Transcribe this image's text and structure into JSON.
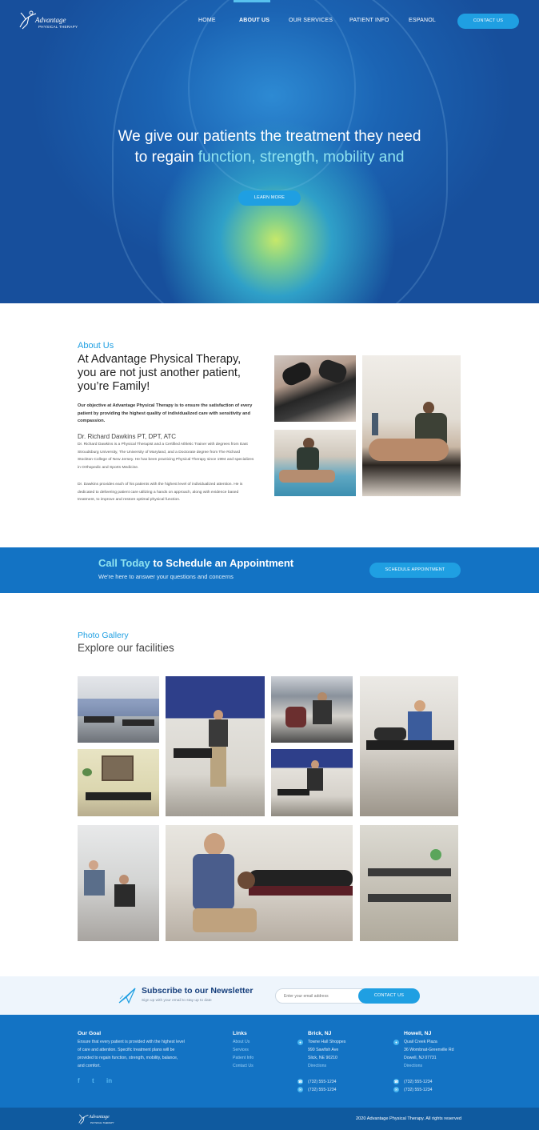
{
  "header": {
    "logo_name": "Advantage",
    "logo_sub": "PHYSICAL THERAPY",
    "nav": [
      "HOME",
      "ABOUT US",
      "OUR SERVICES",
      "PATIENT INFO",
      "ESPANOL"
    ],
    "active_nav": "ABOUT US",
    "contact_button": "CONTACT US"
  },
  "hero": {
    "line1": "We give our patients the treatment they need",
    "line2_plain": "to regain ",
    "line2_highlight": "function, strength, mobility and",
    "button": "LEARN MORE"
  },
  "about": {
    "kicker": "About Us",
    "title": "At Advantage Physical Therapy, you are not just another patient, you’re Family!",
    "intro": "Our objective at Advantage Physical Therapy is to ensure the satisfaction of every patient by providing the highest quality of individualized care with sensitivity and compassion.",
    "doctor": "Dr. Richard Dawkins PT, DPT, ATC",
    "bio1": "Dr. Richard Dawkins is a Physical Therapist and a Certified Athletic Trainer with degrees from East Stroudsburg University, The University of Maryland, and a Doctorate degree from The Richard Stockton College of New Jersey. He has been practicing Physical Therapy since 1994 and specializes in Orthopedic and Sports Medicine.",
    "bio2": "Dr. Dawkins provides each of his patients with the highest level of individualized attention. He is dedicated to delivering patient care utilizing a hands on approach, along with evidence based treatment, to improve and restore optimal physical function."
  },
  "cta": {
    "highlight": "Call Today",
    "title_rest": " to Schedule an Appointment",
    "subtitle": "We're here to answer your questions and concerns",
    "button": "SCHEDULE APPOINTMENT"
  },
  "gallery": {
    "kicker": "Photo Gallery",
    "title": "Explore our facilities"
  },
  "newsletter": {
    "title": "Subscribe to our Newsletter",
    "subtitle": "Sign up with your email to stay up to date",
    "placeholder": "Enter your email address",
    "button": "CONTACT US"
  },
  "footer": {
    "goal_title": "Our Goal",
    "goal_text": [
      "Ensure that every patient is provided with the highest level",
      "of care and attention. Specific treatment plans will be",
      "provided to regain function, strength, mobility, balance,",
      "and comfort."
    ],
    "links_title": "Links",
    "links": [
      "About Us",
      "Services",
      "Patient Info",
      "Contact Us"
    ],
    "brick": {
      "title": "Brick, NJ",
      "lines": [
        "Towne Hall Shoppes",
        "990 Sawfish Ave",
        "Slick, NE 90210"
      ],
      "directions": "Directions",
      "phone": "(732) 555-1234",
      "fax": "(732) 555-1234"
    },
    "howell": {
      "title": "Howell, NJ",
      "lines": [
        "Quail Creek Plaza",
        "36 Wombnat-Greenville Rd",
        "Dowell, NJ 07731"
      ],
      "directions": "Directions",
      "phone": "(732) 555-1234",
      "fax": "(732) 555-1234"
    },
    "social": [
      "f",
      "t",
      "in"
    ],
    "copyright": "2020 Advantage Physical Therapy. All rights reserved"
  },
  "colors": {
    "brand_blue": "#1373c4",
    "accent": "#1f9fe2",
    "highlight": "#8fe3f0",
    "navy": "#163f7c"
  }
}
